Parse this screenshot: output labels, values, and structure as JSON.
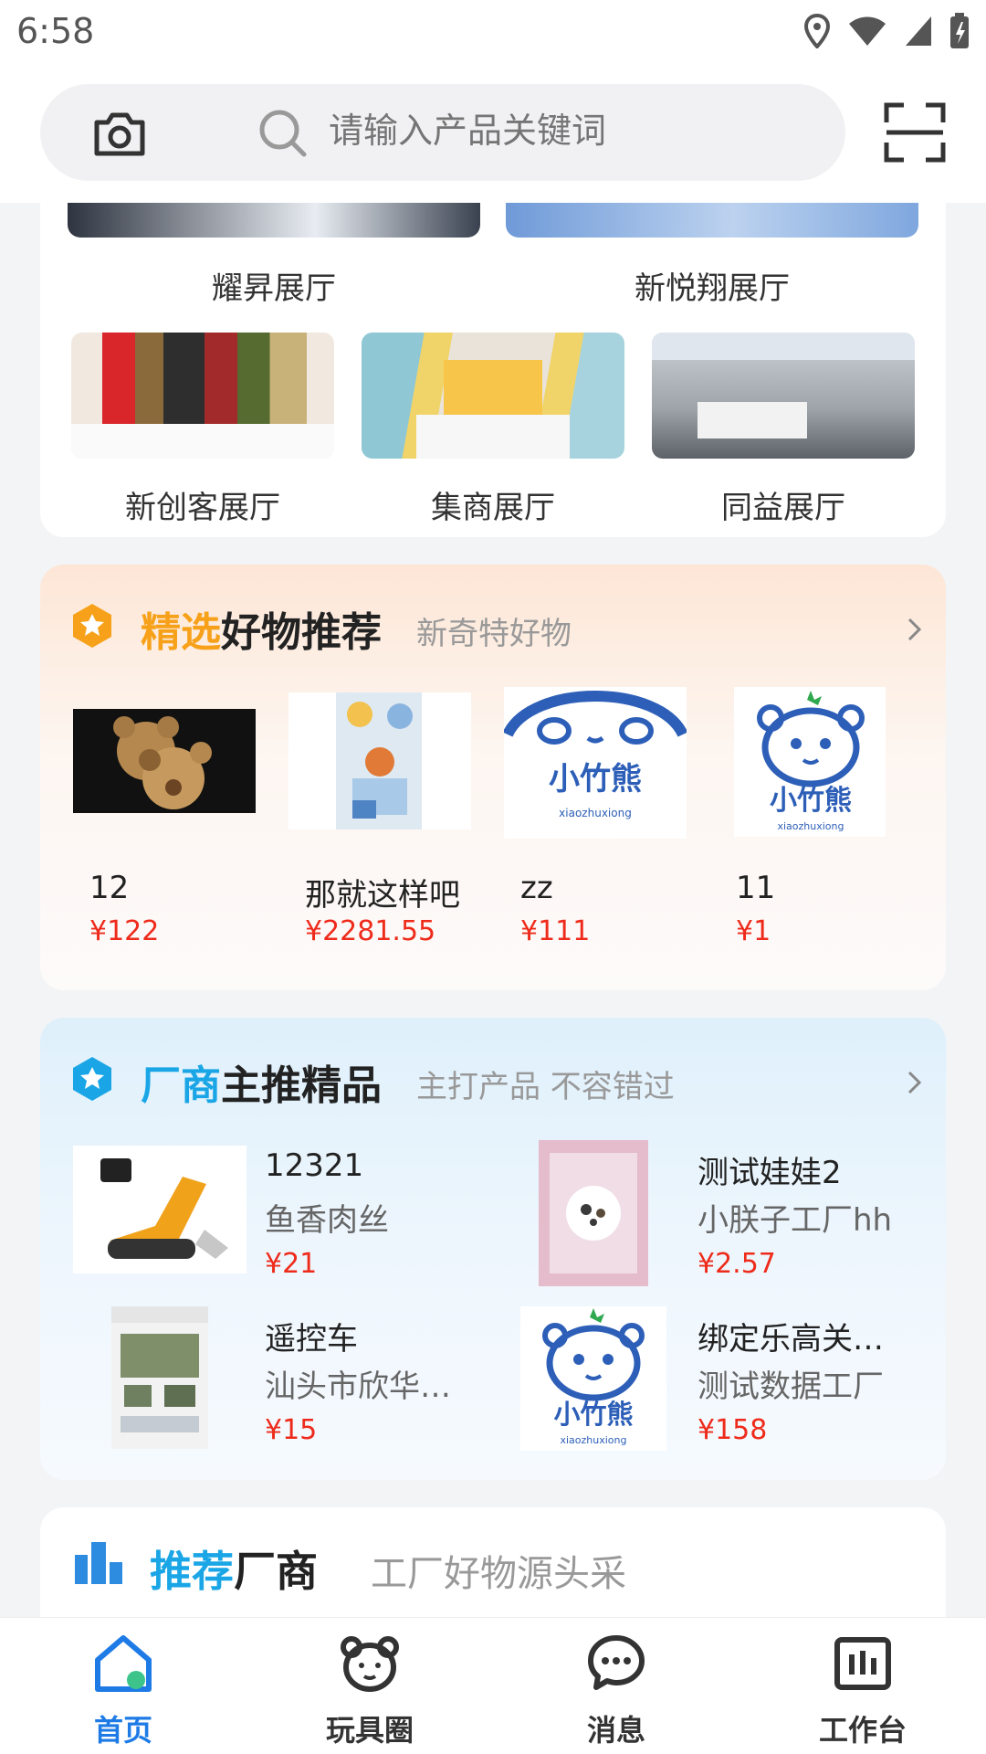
{
  "status_bar": {
    "time": "6:58"
  },
  "search": {
    "placeholder": "请输入产品关键词"
  },
  "halls": {
    "top_row": [
      {
        "name": "耀昇展厅"
      },
      {
        "name": "新悦翔展厅"
      }
    ],
    "row": [
      {
        "name": "新创客展厅"
      },
      {
        "name": "集商展厅"
      },
      {
        "name": "同益展厅"
      }
    ]
  },
  "selected_goods": {
    "title_highlight": "精选",
    "title_rest": "好物推荐",
    "subtitle": "新奇特好物",
    "products": [
      {
        "name": "12",
        "price": "¥122"
      },
      {
        "name": "那就这样吧",
        "price": "¥2281.55"
      },
      {
        "name": "zz",
        "price": "¥111"
      },
      {
        "name": "11",
        "price": "¥1"
      }
    ]
  },
  "factory_picks": {
    "title_highlight": "厂商",
    "title_rest": "主推精品",
    "subtitle": "主打产品 不容错过",
    "items": [
      {
        "name": "12321",
        "maker": "鱼香肉丝",
        "price": "¥21"
      },
      {
        "name": "测试娃娃2",
        "maker": "小朕子工厂hh",
        "price": "¥2.57"
      },
      {
        "name": "遥控车",
        "maker": "汕头市欣华…",
        "price": "¥15"
      },
      {
        "name": "绑定乐高关…",
        "maker": "测试数据工厂",
        "price": "¥158"
      }
    ]
  },
  "recommended_factories": {
    "title_highlight": "推荐",
    "title_rest": "厂商",
    "subtitle": "工厂好物源头采"
  },
  "brand_logo": {
    "text": "小竹熊",
    "latin": "xiaozhuxiong"
  },
  "bottom_nav": [
    {
      "label": "首页",
      "active": true
    },
    {
      "label": "玩具圈",
      "active": false
    },
    {
      "label": "消息",
      "active": false
    },
    {
      "label": "工作台",
      "active": false
    }
  ],
  "colors": {
    "accent_blue": "#1e7be6",
    "highlight_orange": "#f7a11a",
    "highlight_cyan": "#1aa6e6",
    "price_red": "#ee2b1b"
  }
}
